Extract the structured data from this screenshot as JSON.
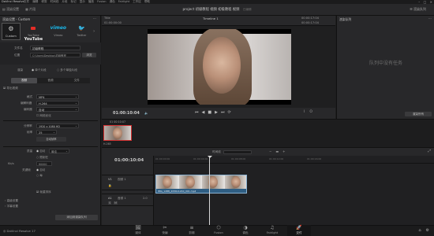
{
  "menubar": {
    "app_name": "DaVinci Resolve",
    "items": [
      "文件",
      "编辑",
      "修剪",
      "时间线",
      "片段",
      "标记",
      "显示",
      "播放",
      "Fusion",
      "调色",
      "Fairlight",
      "工作区",
      "帮助"
    ]
  },
  "toolbar": {
    "left": [
      "渲染设置",
      "片段"
    ],
    "project_title": "project 初级教程 视频 初级教程 视频",
    "project_status": "已编辑"
  },
  "render_panel": {
    "title": "渲染设置 - Custom",
    "presets": [
      {
        "label": "Custom",
        "logo": "⚙"
      },
      {
        "label": "YouTube",
        "logo": "YouTube"
      },
      {
        "label": "Vimeo",
        "logo": "vimeo"
      },
      {
        "label": "Twitter",
        "logo": "🐦"
      }
    ],
    "filename_label": "文件名",
    "filename_value": "初级教程",
    "location_label": "位置",
    "location_value": "C:\\Users\\Desktop\\初级教程",
    "browse_label": "浏览",
    "render_label": "渲染",
    "render_options": [
      "单个片段",
      "多个单独片段"
    ],
    "tabs": [
      "视频",
      "音频",
      "文件"
    ],
    "export_video_label": "导出视频",
    "format_label": "格式",
    "format_value": "MP4",
    "codec_label": "编解码器",
    "codec_value": "H.264",
    "encoder_label": "编码器",
    "encoder_value": "自动",
    "network_opt": "网络优化",
    "resolution_label": "分辨率",
    "resolution_value": "1920 x 1080 HD",
    "framerate_label": "帧率",
    "framerate_value": "25",
    "quality_toggle": "自动帧率",
    "quality_label": "质量",
    "quality_options": [
      "自动",
      "最佳"
    ],
    "restrict_label": "限制在",
    "restrict_value": "80000",
    "keyframe_label": "关键帧",
    "keyframe_options": [
      "自动",
      "每"
    ],
    "frame_reorder": "帧重排序",
    "advanced": [
      "高级设置",
      "字幕设置"
    ],
    "add_queue": "添加到渲染队列"
  },
  "viewer": {
    "source_label": "Title",
    "timecode_in": "01:00:00:00",
    "timeline_name": "Timeline 1",
    "duration_label": "00:00:17:04",
    "current_timecode": "01:00:10:04",
    "tc_right": "00:00:17:04"
  },
  "queue": {
    "title": "渲染队列",
    "empty_text": "队列中没有任务",
    "render_all": "渲染所有"
  },
  "clip_strip": {
    "clip_name": "01 00:10:07",
    "clip_label": "H.265"
  },
  "timeline": {
    "timecode": "01:00:10:04",
    "ruler_marks": [
      "01:00:00:00",
      "01:00:04:00",
      "01:00:08:00",
      "01:00:12:00",
      "01:00:16:00"
    ],
    "video_track": "V1",
    "video_track_name": "视频 1",
    "audio_track": "A1",
    "audio_track_name": "音频 1",
    "audio_level": "2.0",
    "clip_name": "IMG_1288_2056x1240_001.mp4",
    "view_label": "时间线"
  },
  "pages": [
    {
      "label": "媒体",
      "icon": "🖼"
    },
    {
      "label": "快编",
      "icon": "✂"
    },
    {
      "label": "剪辑",
      "icon": "≡"
    },
    {
      "label": "Fusion",
      "icon": "⬡"
    },
    {
      "label": "调色",
      "icon": "◑"
    },
    {
      "label": "Fairlight",
      "icon": "♫"
    },
    {
      "label": "交付",
      "icon": "🚀"
    }
  ],
  "status": {
    "app_version": "DaVinci Resolve 17"
  }
}
